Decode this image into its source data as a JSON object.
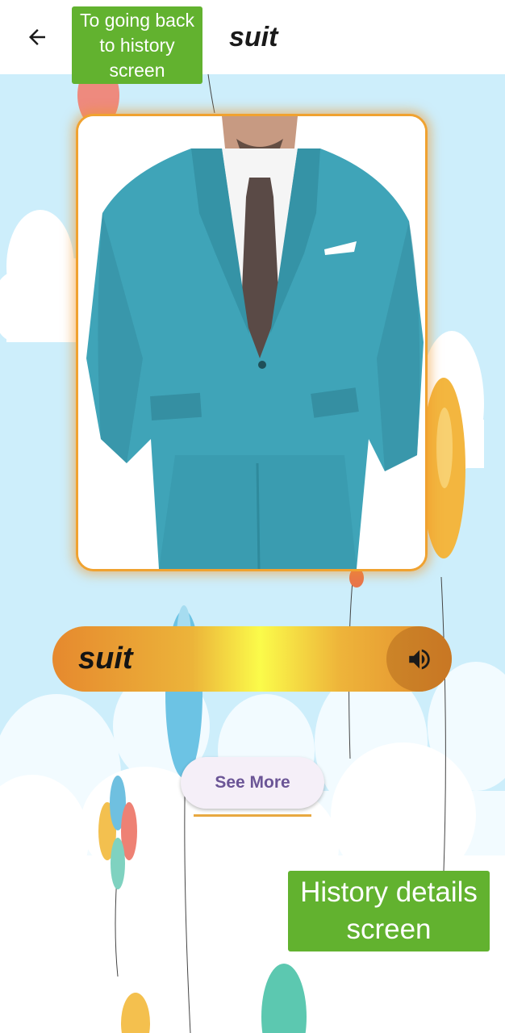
{
  "appbar": {
    "title": "suit",
    "back_icon": "arrow-left-icon"
  },
  "annotations": {
    "back_note": "To going back to history screen",
    "screen_note": "History details screen"
  },
  "card": {
    "image": "man-in-teal-suit-photo"
  },
  "word_bar": {
    "word": "suit",
    "speaker_icon": "speaker-icon"
  },
  "see_more": {
    "label": "See More"
  },
  "colors": {
    "annotation_green": "#62b22f",
    "card_border": "#f0a230",
    "button_text": "#6b5596",
    "background_sky": "#cdeefb"
  }
}
